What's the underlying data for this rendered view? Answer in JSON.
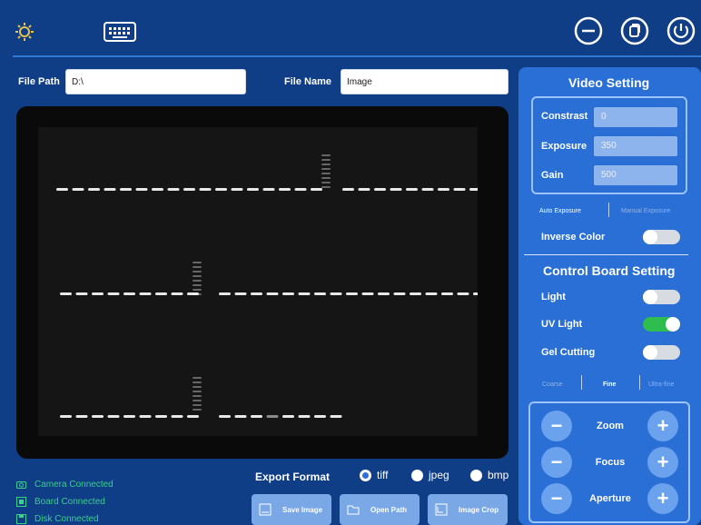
{
  "toolbar": {
    "icons": [
      "bulb-icon",
      "keyboard-icon",
      "minimize-icon",
      "restore-icon",
      "power-icon"
    ]
  },
  "file": {
    "path_label": "File Path",
    "path_value": "D:\\",
    "name_label": "File Name",
    "name_value": "Image"
  },
  "status": {
    "items": [
      "Camera Connected",
      "Board Connected",
      "Disk Connected"
    ],
    "color": "#38d08a"
  },
  "export": {
    "label": "Export Format",
    "options": [
      "tiff",
      "jpeg",
      "bmp"
    ],
    "selected": "tiff"
  },
  "actions": {
    "save": "Save Image",
    "open": "Open Path",
    "crop": "Image Crop"
  },
  "video": {
    "title": "Video Setting",
    "contrast_label": "Constrast",
    "contrast_value": "0",
    "exposure_label": "Exposure",
    "exposure_value": "350",
    "gain_label": "Gain",
    "gain_value": "500",
    "auto_exposure": "Auto Exposure",
    "manual_exposure": "Manual Exposure",
    "inverse_label": "Inverse Color",
    "inverse_on": false
  },
  "board": {
    "title": "Control Board Setting",
    "light_label": "Light",
    "light_on": false,
    "uv_label": "UV Light",
    "uv_on": true,
    "gel_label": "Gel Cutting",
    "gel_on": false,
    "modes": [
      "Coarse",
      "Fine",
      "Ultra-fine"
    ],
    "selected_mode": "Fine"
  },
  "controls": {
    "zoom": "Zoom",
    "focus": "Focus",
    "aperture": "Aperture"
  },
  "colors": {
    "background": "#0f3d86",
    "panel": "#2a6fd5",
    "toggle_on": "#2ebd4e"
  }
}
